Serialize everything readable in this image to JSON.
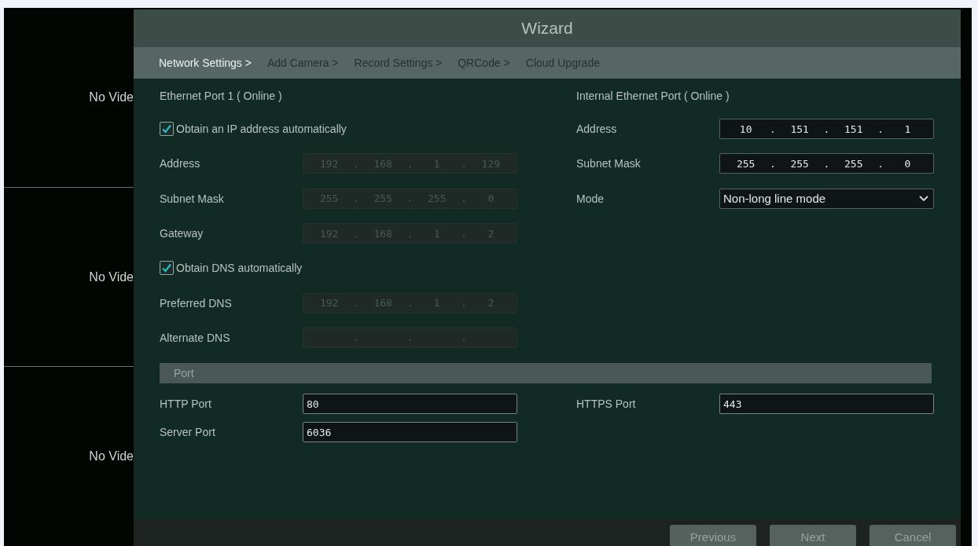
{
  "video_tiles": [
    {
      "label": "No Vide"
    },
    {
      "label": "No Vide"
    },
    {
      "label": "No Vide"
    }
  ],
  "window": {
    "title": "Wizard"
  },
  "steps": [
    {
      "label": "Network Settings >",
      "selected": true
    },
    {
      "label": "Add Camera >",
      "selected": false
    },
    {
      "label": "Record Settings >",
      "selected": false
    },
    {
      "label": "QRCode >",
      "selected": false
    },
    {
      "label": "Cloud Upgrade",
      "selected": false
    }
  ],
  "ethernet": {
    "heading": "Ethernet Port 1 ( Online )",
    "rows": [
      {
        "kind": "checkbox",
        "label": "Obtain an IP address automatically",
        "checked": true
      },
      {
        "kind": "ip",
        "label": "Address",
        "disabled": true,
        "segments": [
          "192",
          "168",
          "1",
          "129"
        ],
        "separators": [
          ".",
          ".",
          "."
        ]
      },
      {
        "kind": "ip",
        "label": "Subnet Mask",
        "disabled": true,
        "segments": [
          "255",
          "255",
          "255",
          "0"
        ],
        "separators": [
          ".",
          ".",
          "."
        ]
      },
      {
        "kind": "ip",
        "label": "Gateway",
        "disabled": true,
        "segments": [
          "192",
          "168",
          "1",
          "2"
        ],
        "separators": [
          ".",
          ".",
          "."
        ]
      },
      {
        "kind": "checkbox",
        "label": "Obtain DNS automatically",
        "checked": true
      },
      {
        "kind": "ip",
        "label": "Preferred DNS",
        "disabled": true,
        "segments": [
          "192",
          "168",
          "1",
          "2"
        ],
        "separators": [
          ".",
          ".",
          "."
        ]
      },
      {
        "kind": "ip",
        "label": "Alternate DNS",
        "disabled": true,
        "separators": [
          ".",
          ".",
          "."
        ]
      }
    ]
  },
  "internal": {
    "heading": "Internal Ethernet Port ( Online )",
    "rows": [
      {
        "kind": "ip",
        "label": "Address",
        "disabled": false,
        "segments": [
          "10",
          "151",
          "151",
          "1"
        ],
        "separators": [
          ".",
          ".",
          "."
        ]
      },
      {
        "kind": "ip",
        "label": "Subnet Mask",
        "disabled": false,
        "segments": [
          "255",
          "255",
          "255",
          "0"
        ],
        "separators": [
          ".",
          ".",
          "."
        ]
      },
      {
        "kind": "select",
        "label": "Mode",
        "value": "Non-long line mode"
      }
    ]
  },
  "port": {
    "heading": "Port",
    "left": [
      {
        "label": "HTTP Port",
        "value": "80"
      },
      {
        "label": "Server Port",
        "value": "6036"
      }
    ],
    "right": [
      {
        "label": "HTTPS Port",
        "value": "443"
      }
    ]
  },
  "buttons": [
    "Previous",
    "Next",
    "Cancel"
  ]
}
